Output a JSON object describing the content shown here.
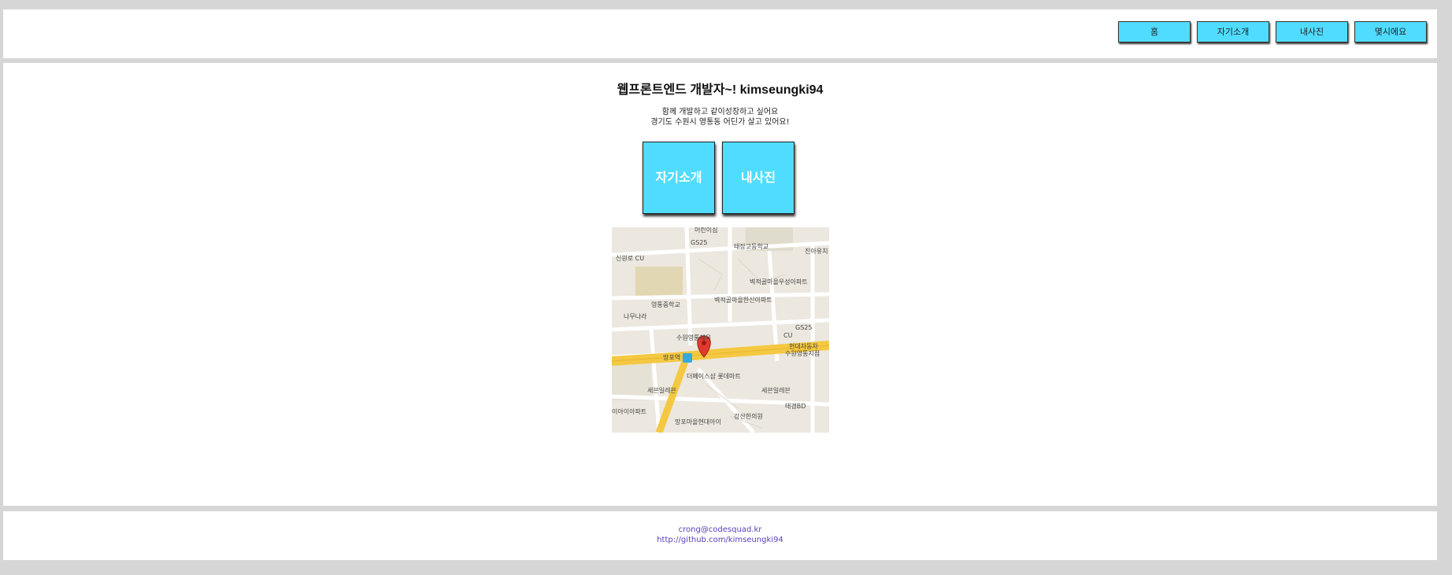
{
  "nav": {
    "home": "홈",
    "intro": "자기소개",
    "photos": "내사진",
    "contact": "몇시에요"
  },
  "main": {
    "title": "웹프론트엔드 개발자~! kimseungki94",
    "desc_line1": "함께 개발하고 같이성장하고 싶어요",
    "desc_line2": "경기도 수원시 영통동 어딘가 살고 있어요!",
    "intro_button": "자기소개",
    "photos_button": "내사진"
  },
  "map": {
    "labels": [
      "어린이집",
      "GS25",
      "태장고등학교",
      "진아유치",
      "신원로 CU",
      "벽적골마을우성아파트",
      "영통중학교",
      "벽적골마을한신아파트",
      "나무나라",
      "GS25",
      "수원영통체육",
      "CU",
      "현대자동차",
      "수원영통지점",
      "망포역",
      "더페이스샵 롯데마트",
      "세븐일레븐",
      "세븐일레븐",
      "태경BD",
      "이아이아파트",
      "망포마을현대아이",
      "강산한의원"
    ],
    "accent_road": "#f5c842",
    "marker_color": "#e03a2f"
  },
  "footer": {
    "email": "crong@codesquad.kr",
    "github": "http://github.com/kimseungki94"
  }
}
